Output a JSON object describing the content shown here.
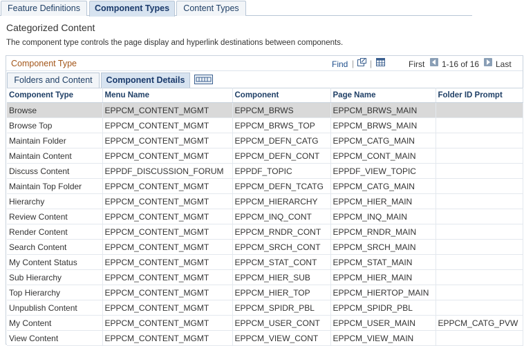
{
  "top_tabs": [
    {
      "label": "Feature Definitions",
      "active": false
    },
    {
      "label": "Component Types",
      "active": true
    },
    {
      "label": "Content Types",
      "active": false
    }
  ],
  "page_title": "Categorized Content",
  "description": "The component type controls the page display and hyperlink destinations between components.",
  "grid": {
    "title": "Component Type",
    "find_label": "Find",
    "separator": "|",
    "first_label": "First",
    "count": "1-16 of 16",
    "last_label": "Last",
    "sub_tabs": [
      {
        "label": "Folders and Content",
        "active": false
      },
      {
        "label": "Component Details",
        "active": true
      }
    ],
    "columns": [
      "Component Type",
      "Menu Name",
      "Component",
      "Page Name",
      "Folder ID Prompt"
    ],
    "rows": [
      [
        "Browse",
        "EPPCM_CONTENT_MGMT",
        "EPPCM_BRWS",
        "EPPCM_BRWS_MAIN",
        ""
      ],
      [
        "Browse Top",
        "EPPCM_CONTENT_MGMT",
        "EPPCM_BRWS_TOP",
        "EPPCM_BRWS_MAIN",
        ""
      ],
      [
        "Maintain Folder",
        "EPPCM_CONTENT_MGMT",
        "EPPCM_DEFN_CATG",
        "EPPCM_CATG_MAIN",
        ""
      ],
      [
        "Maintain Content",
        "EPPCM_CONTENT_MGMT",
        "EPPCM_DEFN_CONT",
        "EPPCM_CONT_MAIN",
        ""
      ],
      [
        "Discuss Content",
        "EPPDF_DISCUSSION_FORUM",
        "EPPDF_TOPIC",
        "EPPDF_VIEW_TOPIC",
        ""
      ],
      [
        "Maintain Top Folder",
        "EPPCM_CONTENT_MGMT",
        "EPPCM_DEFN_TCATG",
        "EPPCM_CATG_MAIN",
        ""
      ],
      [
        "Hierarchy",
        "EPPCM_CONTENT_MGMT",
        "EPPCM_HIERARCHY",
        "EPPCM_HIER_MAIN",
        ""
      ],
      [
        "Review Content",
        "EPPCM_CONTENT_MGMT",
        "EPPCM_INQ_CONT",
        "EPPCM_INQ_MAIN",
        ""
      ],
      [
        "Render Content",
        "EPPCM_CONTENT_MGMT",
        "EPPCM_RNDR_CONT",
        "EPPCM_RNDR_MAIN",
        ""
      ],
      [
        "Search Content",
        "EPPCM_CONTENT_MGMT",
        "EPPCM_SRCH_CONT",
        "EPPCM_SRCH_MAIN",
        ""
      ],
      [
        "My Content Status",
        "EPPCM_CONTENT_MGMT",
        "EPPCM_STAT_CONT",
        "EPPCM_STAT_MAIN",
        ""
      ],
      [
        "Sub Hierarchy",
        "EPPCM_CONTENT_MGMT",
        "EPPCM_HIER_SUB",
        "EPPCM_HIER_MAIN",
        ""
      ],
      [
        "Top Hierarchy",
        "EPPCM_CONTENT_MGMT",
        "EPPCM_HIER_TOP",
        "EPPCM_HIERTOP_MAIN",
        ""
      ],
      [
        "Unpublish Content",
        "EPPCM_CONTENT_MGMT",
        "EPPCM_SPIDR_PBL",
        "EPPCM_SPIDR_PBL",
        ""
      ],
      [
        "My Content",
        "EPPCM_CONTENT_MGMT",
        "EPPCM_USER_CONT",
        "EPPCM_USER_MAIN",
        "EPPCM_CATG_PVW"
      ],
      [
        "View Content",
        "EPPCM_CONTENT_MGMT",
        "EPPCM_VIEW_CONT",
        "EPPCM_VIEW_MAIN",
        ""
      ]
    ],
    "selected_row": 0
  },
  "icons": {
    "zoom": "zoom-window-icon",
    "download": "spreadsheet-download-icon",
    "prev": "previous-arrow-icon",
    "next": "next-arrow-icon",
    "show_all": "show-all-columns-icon"
  },
  "colors": {
    "grid_title": "#a35619",
    "link": "#1f4f8c",
    "selected_row": "#d9d9d9",
    "active_tab": "#d7e3f0"
  }
}
